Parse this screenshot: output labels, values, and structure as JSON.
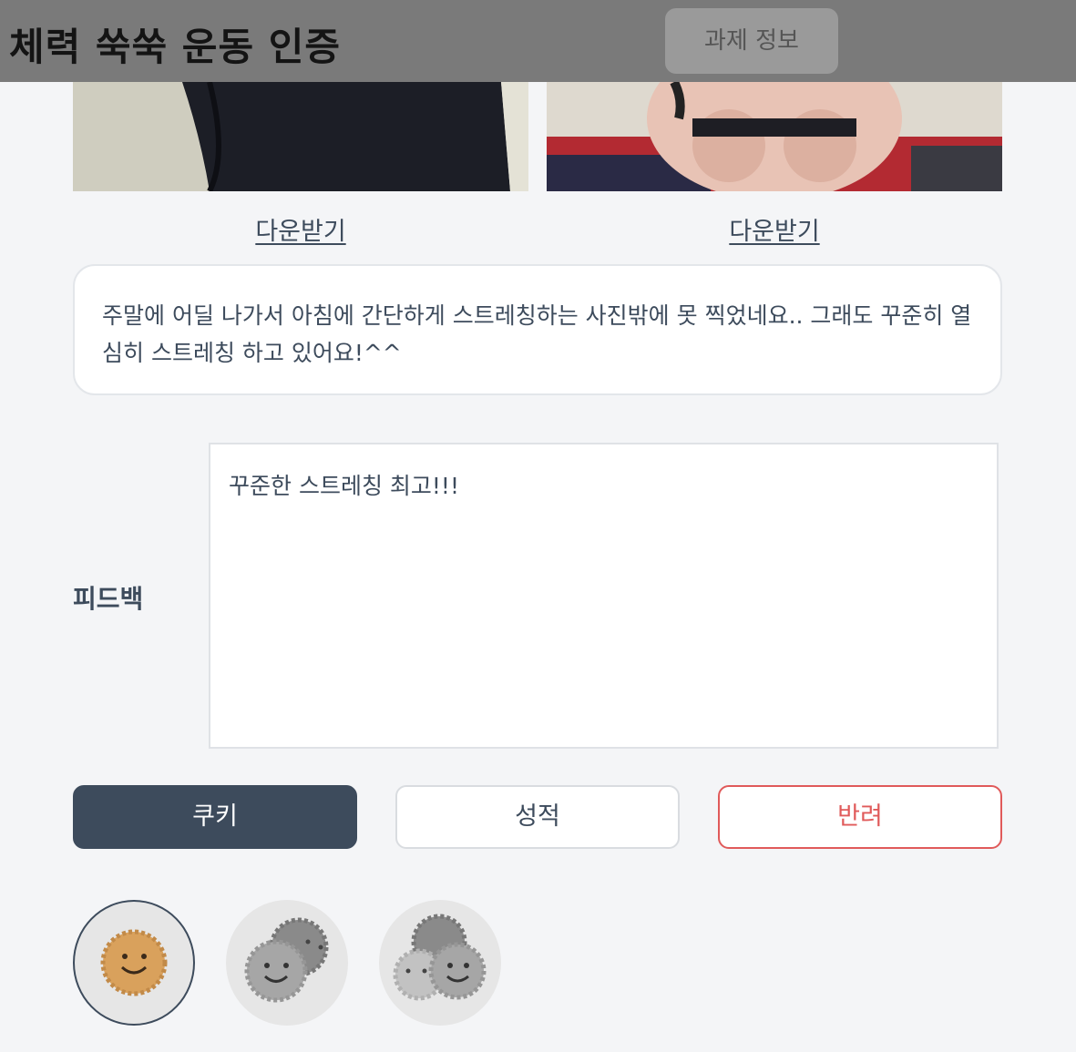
{
  "header": {
    "title": "체력 쑥쑥 운동 인증",
    "task_info_button": "과제 정보"
  },
  "photos": {
    "left_download": "다운받기",
    "right_download": "다운받기"
  },
  "caption": "주말에 어딜 나가서 아침에 간단하게 스트레칭하는 사진밖에 못 찍었네요.. 그래도 꾸준히 열심히 스트레칭 하고 있어요!^^",
  "feedback": {
    "label": "피드백",
    "value": "꾸준한 스트레칭 최고!!!"
  },
  "actions": {
    "cookie": "쿠키",
    "grade": "성적",
    "reject": "반려"
  },
  "cookie_options": [
    {
      "count": 1,
      "selected": true
    },
    {
      "count": 2,
      "selected": false
    },
    {
      "count": 3,
      "selected": false
    }
  ],
  "colors": {
    "primary": "#3d4b5c",
    "danger": "#e05a5a",
    "header_bg": "#7a7a7a",
    "cookie_selected": "#d9a15c",
    "cookie_inactive": "#9e9e9e"
  }
}
